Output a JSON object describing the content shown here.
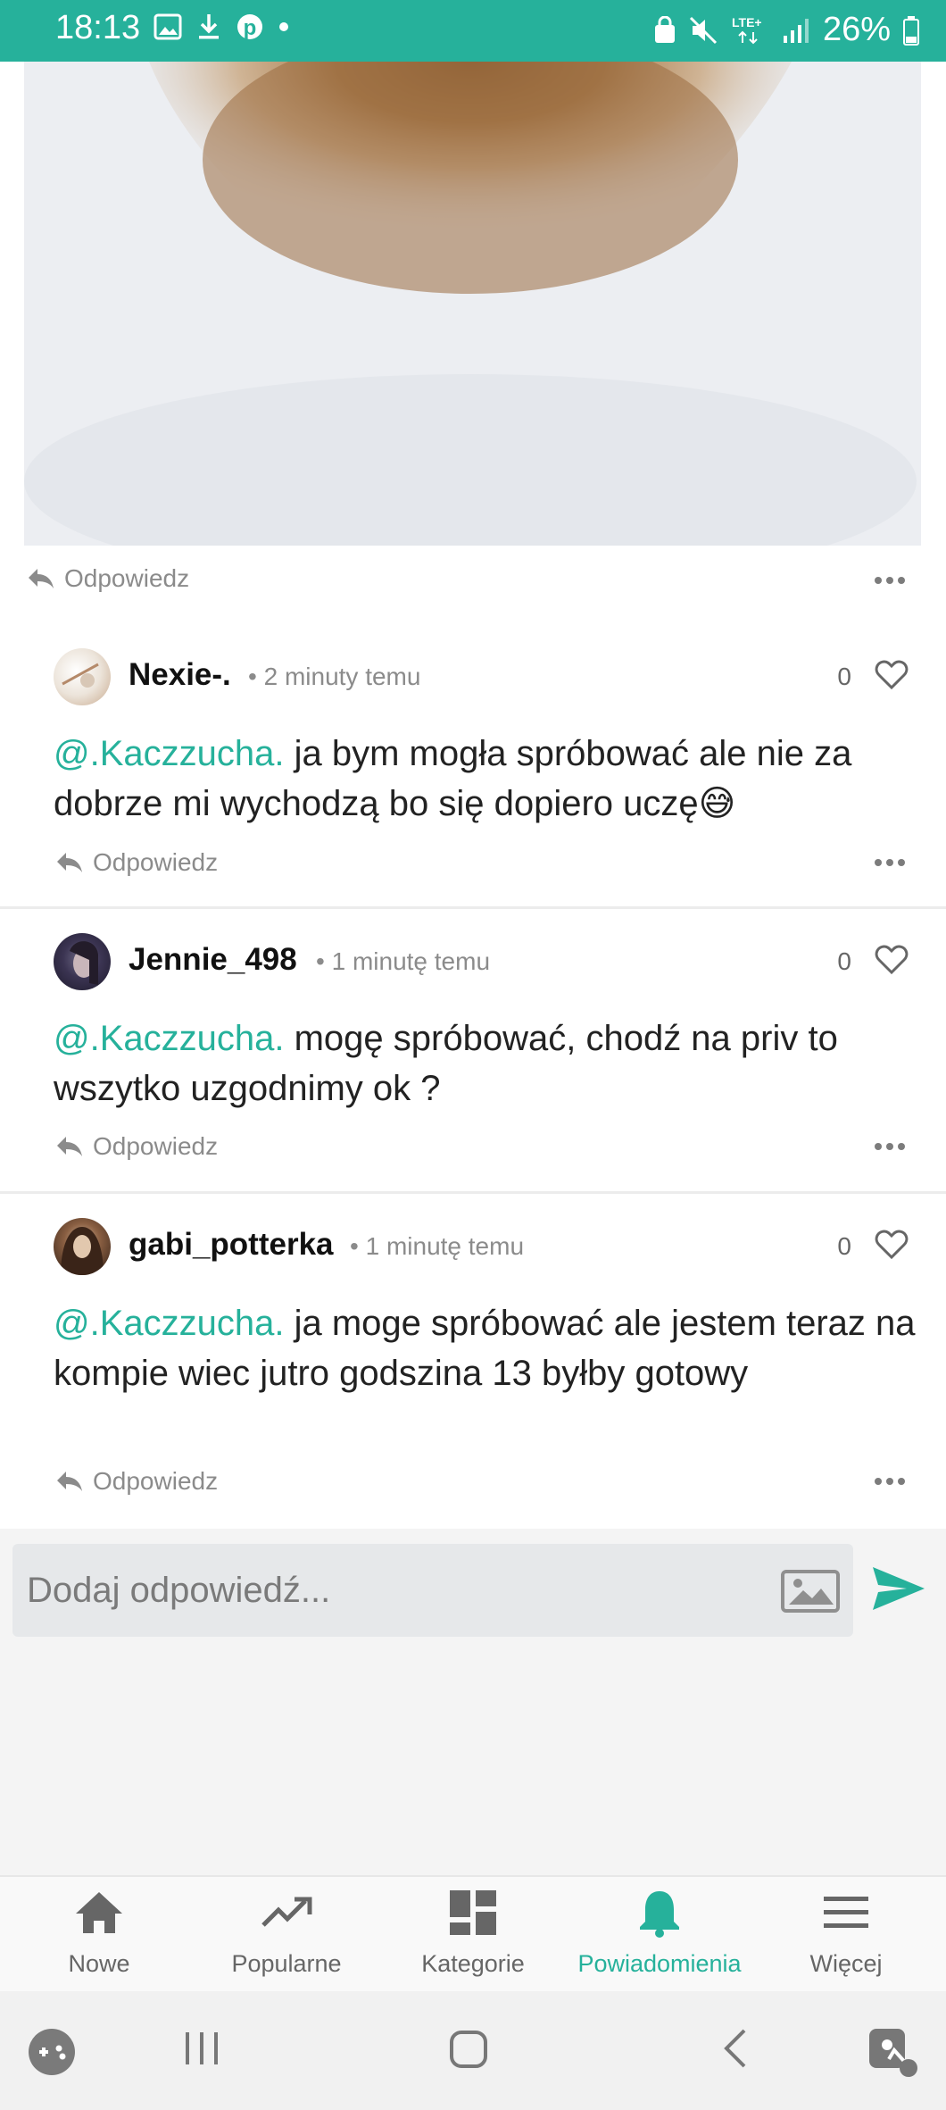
{
  "status_bar": {
    "time": "18:13",
    "network": "LTE+",
    "battery": "26%"
  },
  "colors": {
    "accent": "#26b19b",
    "status_bar": "#26b19b"
  },
  "post": {
    "reply_label": "Odpowiedz"
  },
  "comments": [
    {
      "username": "Nexie-.",
      "time": "2 minuty temu",
      "likes": "0",
      "mention": "@.Kaczzucha.",
      "text": " ja bym mogła spróbować ale nie za dobrze mi wychodzą bo się dopiero uczę😅",
      "reply_label": "Odpowiedz"
    },
    {
      "username": "Jennie_498",
      "time": "1 minutę temu",
      "likes": "0",
      "mention": "@.Kaczzucha.",
      "text": " mogę spróbować, chodź na priv to wszytko uzgodnimy ok ?",
      "reply_label": "Odpowiedz"
    },
    {
      "username": "gabi_potterka",
      "time": "1 minutę temu",
      "likes": "0",
      "mention": "@.Kaczzucha.",
      "text": " ja moge spróbować ale jestem teraz na kompie wiec jutro godszina 13 byłby gotowy",
      "reply_label": "Odpowiedz"
    }
  ],
  "composer": {
    "placeholder": "Dodaj odpowiedź..."
  },
  "bottom_nav": [
    {
      "label": "Nowe",
      "icon": "home-icon"
    },
    {
      "label": "Popularne",
      "icon": "trending-icon"
    },
    {
      "label": "Kategorie",
      "icon": "dashboard-icon"
    },
    {
      "label": "Powiadomienia",
      "icon": "bell-icon",
      "active": true
    },
    {
      "label": "Więcej",
      "icon": "menu-icon"
    }
  ]
}
